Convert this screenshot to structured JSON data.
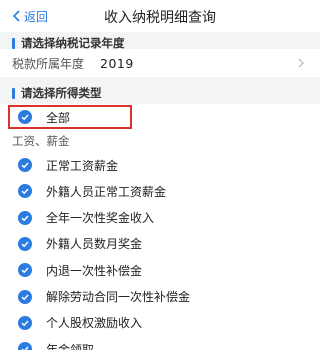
{
  "nav": {
    "back_label": "返回",
    "title": "收入纳税明细查询"
  },
  "year_section": {
    "title": "请选择纳税记录年度",
    "label": "税款所属年度",
    "value": "2019"
  },
  "type_section": {
    "title": "请选择所得类型"
  },
  "all_option": {
    "label": "全部",
    "checked": true
  },
  "group": {
    "label": "工资、薪金"
  },
  "items": [
    {
      "label": "正常工资薪金",
      "checked": true
    },
    {
      "label": "外籍人员正常工资薪金",
      "checked": true
    },
    {
      "label": "全年一次性奖金收入",
      "checked": true
    },
    {
      "label": "外籍人员数月奖金",
      "checked": true
    },
    {
      "label": "内退一次性补偿金",
      "checked": true
    },
    {
      "label": "解除劳动合同一次性补偿金",
      "checked": true
    },
    {
      "label": "个人股权激励收入",
      "checked": true
    },
    {
      "label": "年金领取",
      "checked": true
    }
  ],
  "colors": {
    "accent": "#2b7be0",
    "highlight": "#d9332b"
  }
}
